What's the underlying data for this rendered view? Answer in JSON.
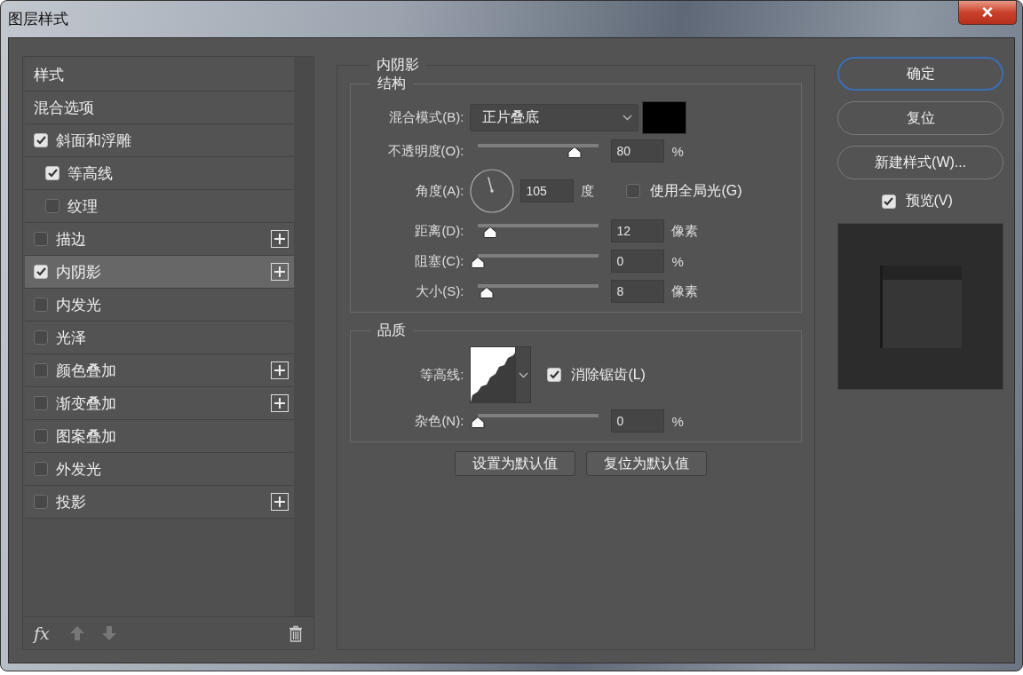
{
  "window": {
    "title": "图层样式",
    "close": "×"
  },
  "sidebar": {
    "items": [
      {
        "label": "样式",
        "kind": "plain",
        "selected": false,
        "add_button": false
      },
      {
        "label": "混合选项",
        "kind": "plain",
        "selected": false,
        "add_button": false
      },
      {
        "label": "斜面和浮雕",
        "kind": "check",
        "checked": true,
        "selected": false,
        "add_button": false,
        "children": [
          {
            "label": "等高线",
            "kind": "check",
            "checked": true,
            "selected": false,
            "add_button": false
          },
          {
            "label": "纹理",
            "kind": "check",
            "checked": false,
            "selected": false,
            "add_button": false
          }
        ]
      },
      {
        "label": "描边",
        "kind": "check",
        "checked": false,
        "selected": false,
        "add_button": true
      },
      {
        "label": "内阴影",
        "kind": "check",
        "checked": true,
        "selected": true,
        "add_button": true
      },
      {
        "label": "内发光",
        "kind": "check",
        "checked": false,
        "selected": false,
        "add_button": false
      },
      {
        "label": "光泽",
        "kind": "check",
        "checked": false,
        "selected": false,
        "add_button": false
      },
      {
        "label": "颜色叠加",
        "kind": "check",
        "checked": false,
        "selected": false,
        "add_button": true
      },
      {
        "label": "渐变叠加",
        "kind": "check",
        "checked": false,
        "selected": false,
        "add_button": true
      },
      {
        "label": "图案叠加",
        "kind": "check",
        "checked": false,
        "selected": false,
        "add_button": false
      },
      {
        "label": "外发光",
        "kind": "check",
        "checked": false,
        "selected": false,
        "add_button": false
      },
      {
        "label": "投影",
        "kind": "check",
        "checked": false,
        "selected": false,
        "add_button": true
      }
    ],
    "footer": {
      "fx_label": "fx"
    }
  },
  "panel": {
    "title": "内阴影",
    "structure": {
      "title": "结构",
      "rows": [
        {
          "kind": "blend",
          "label": "混合模式(B):",
          "value": "正片叠底",
          "color": "#000000"
        },
        {
          "kind": "slider",
          "label": "不透明度(O):",
          "level": 0.8,
          "value": "80",
          "unit": "%"
        },
        {
          "kind": "angle",
          "label": "角度(A):",
          "value": "105",
          "unit": "度",
          "global_light": {
            "label": "使用全局光(G)",
            "checked": false
          }
        },
        {
          "kind": "slider",
          "label": "距离(D):",
          "level": 0.1,
          "value": "12",
          "unit": "像素"
        },
        {
          "kind": "slider",
          "label": "阻塞(C):",
          "level": 0,
          "value": "0",
          "unit": "%"
        },
        {
          "kind": "slider",
          "label": "大小(S):",
          "level": 0.07,
          "value": "8",
          "unit": "像素"
        }
      ]
    },
    "quality": {
      "title": "品质",
      "rows": [
        {
          "kind": "contour",
          "label": "等高线:",
          "anti_alias": {
            "label": "消除锯齿(L)",
            "checked": true
          }
        },
        {
          "kind": "slider",
          "label": "杂色(N):",
          "level": 0,
          "value": "0",
          "unit": "%"
        }
      ]
    },
    "buttons": [
      "设置为默认值",
      "复位为默认值"
    ]
  },
  "actions": {
    "buttons": [
      {
        "label": "确定",
        "default": true
      },
      {
        "label": "复位",
        "default": false
      },
      {
        "label": "新建样式(W)...",
        "default": false
      }
    ],
    "preview": {
      "label": "预览(V)",
      "checked": true
    }
  }
}
